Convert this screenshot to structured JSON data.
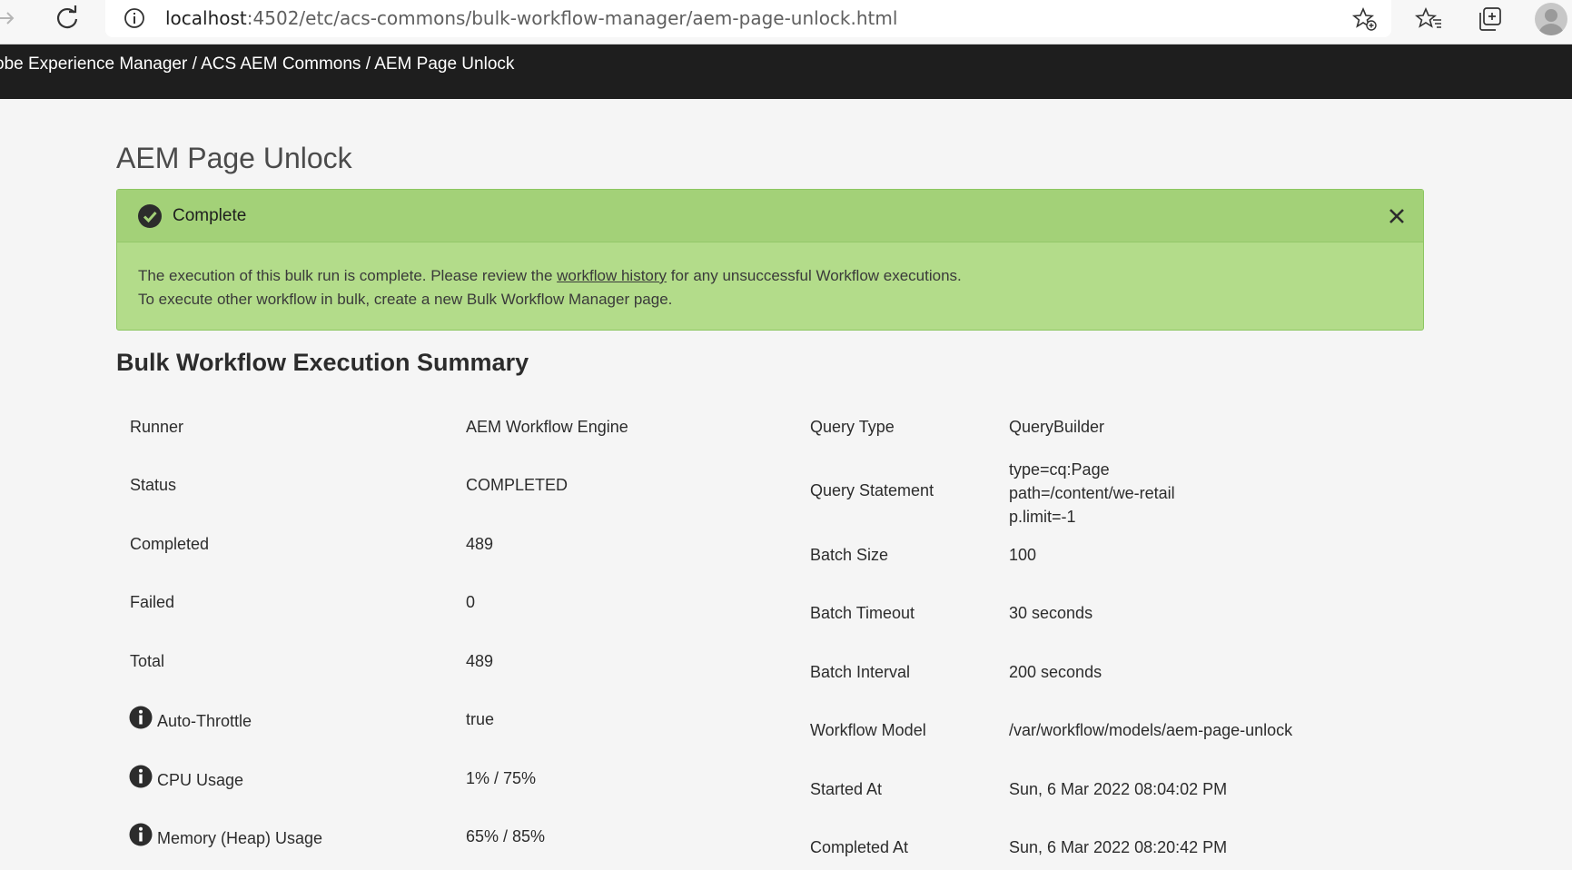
{
  "browser": {
    "url_host": "localhost",
    "url_path": ":4502/etc/acs-commons/bulk-workflow-manager/aem-page-unlock.html"
  },
  "header": {
    "breadcrumb": "obe Experience Manager / ACS AEM Commons / AEM Page Unlock"
  },
  "page": {
    "title": "AEM Page Unlock"
  },
  "alert": {
    "title": "Complete",
    "line1_before": "The execution of this bulk run is complete. Please review the ",
    "link": "workflow history",
    "line1_after": " for any unsuccessful Workflow executions.",
    "line2": "To execute other workflow in bulk, create a new Bulk Workflow Manager page."
  },
  "summary": {
    "title": "Bulk Workflow Execution Summary",
    "left": [
      {
        "label": "Runner",
        "value": "AEM Workflow Engine"
      },
      {
        "label": "Status",
        "value": "COMPLETED"
      },
      {
        "label": "Completed",
        "value": "489"
      },
      {
        "label": "Failed",
        "value": "0"
      },
      {
        "label": "Total",
        "value": "489"
      },
      {
        "label": "Auto-Throttle",
        "value": "true"
      },
      {
        "label": "CPU Usage",
        "value": "1% / 75%"
      },
      {
        "label": "Memory (Heap) Usage",
        "value": "65% / 85%"
      }
    ],
    "right": [
      {
        "label": "Query Type",
        "value": "QueryBuilder"
      },
      {
        "label": "Query Statement",
        "value": [
          "type=cq:Page",
          "path=/content/we-retail",
          "p.limit=-1"
        ]
      },
      {
        "label": "Batch Size",
        "value": "100"
      },
      {
        "label": "Batch Timeout",
        "value": "30 seconds"
      },
      {
        "label": "Batch Interval",
        "value": "200 seconds"
      },
      {
        "label": "Workflow Model",
        "value": "/var/workflow/models/aem-page-unlock"
      },
      {
        "label": "Started At",
        "value": "Sun, 6 Mar 2022 08:04:02 PM"
      },
      {
        "label": "Completed At",
        "value": "Sun, 6 Mar 2022 08:20:42 PM"
      }
    ]
  },
  "colors": {
    "header_bg": "#1e1e1e",
    "alert_bg": "#b3dc8a",
    "alert_head_bg": "#a3d178"
  },
  "icons": [
    "arrow-right-icon",
    "reload-icon",
    "info-icon",
    "add-favorite-icon",
    "favorites-icon",
    "collections-icon",
    "avatar-icon",
    "check-circle-icon",
    "close-icon"
  ]
}
